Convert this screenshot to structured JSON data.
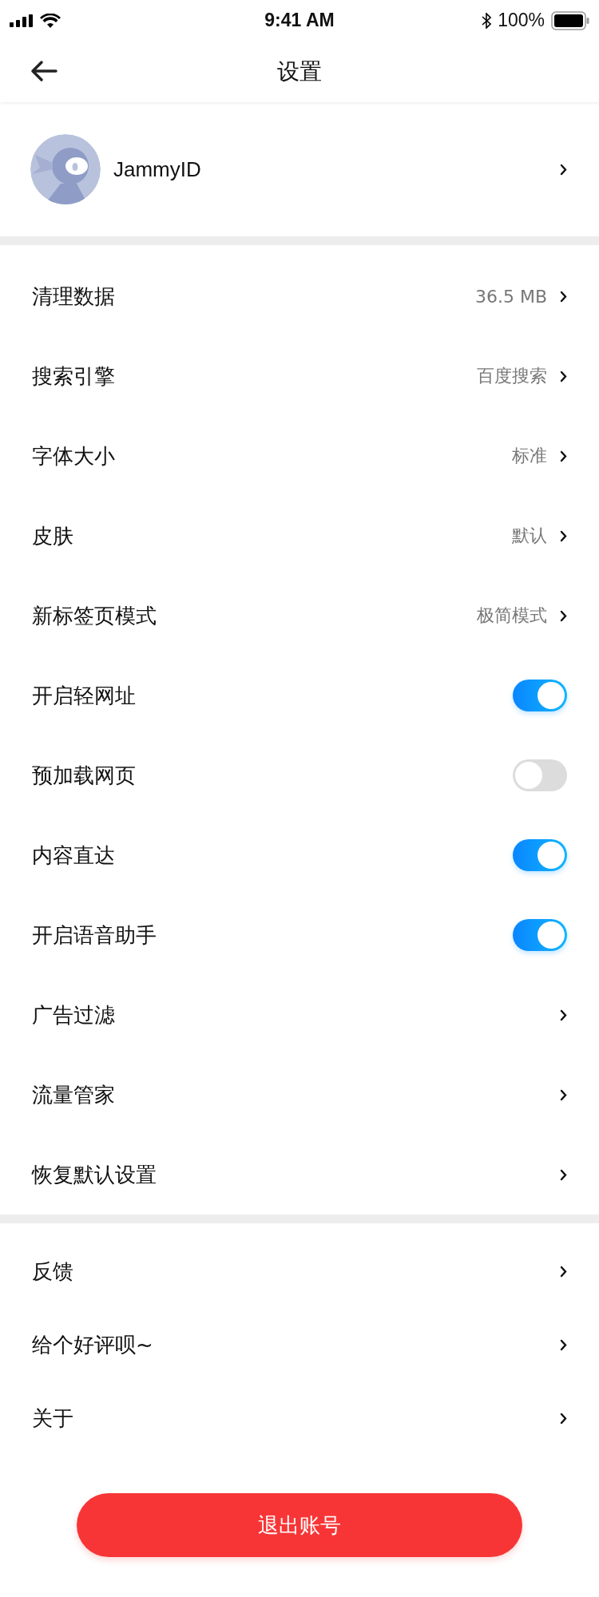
{
  "status_bar": {
    "time": "9:41 AM",
    "battery": "100%"
  },
  "header": {
    "title": "设置"
  },
  "profile": {
    "name": "JammyID"
  },
  "sections": [
    {
      "rows": [
        {
          "kind": "link",
          "label": "清理数据",
          "value": "36.5 MB"
        },
        {
          "kind": "link",
          "label": "搜索引擎",
          "value": "百度搜索"
        },
        {
          "kind": "link",
          "label": "字体大小",
          "value": "标准"
        },
        {
          "kind": "link",
          "label": "皮肤",
          "value": "默认"
        },
        {
          "kind": "link",
          "label": "新标签页模式",
          "value": "极简模式"
        },
        {
          "kind": "toggle",
          "label": "开启轻网址",
          "on": true
        },
        {
          "kind": "toggle",
          "label": "预加载网页",
          "on": false
        },
        {
          "kind": "toggle",
          "label": "内容直达",
          "on": true
        },
        {
          "kind": "toggle",
          "label": "开启语音助手",
          "on": true
        },
        {
          "kind": "link",
          "label": "广告过滤"
        },
        {
          "kind": "link",
          "label": "流量管家"
        },
        {
          "kind": "link",
          "label": "恢复默认设置"
        }
      ]
    },
    {
      "rows": [
        {
          "kind": "link",
          "label": "反馈"
        },
        {
          "kind": "link",
          "label": "给个好评呗~"
        },
        {
          "kind": "link",
          "label": "关于"
        }
      ]
    }
  ],
  "logout_button": "退出账号"
}
